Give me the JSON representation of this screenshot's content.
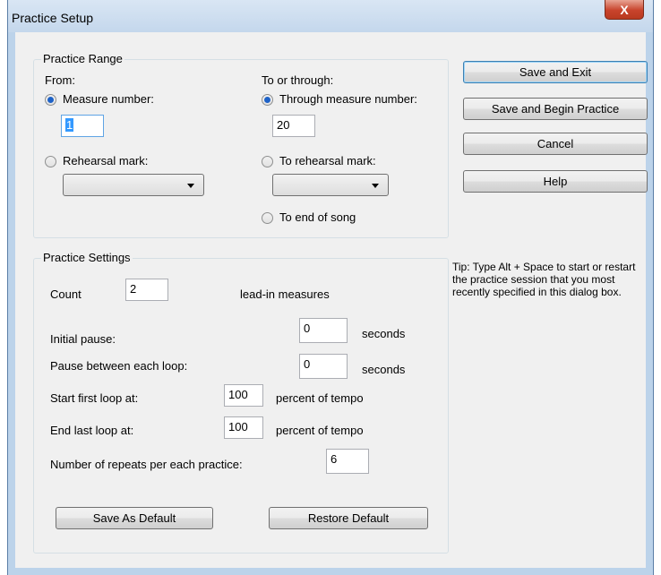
{
  "window": {
    "title": "Practice Setup",
    "close_label": "X"
  },
  "range": {
    "legend": "Practice Range",
    "from_label": "From:",
    "measure_radio": "Measure number:",
    "measure_value": "1",
    "rehearsal_radio": "Rehearsal mark:",
    "to_label": "To or through:",
    "through_radio": "Through measure number:",
    "through_value": "20",
    "to_rehearsal_radio": "To rehearsal mark:",
    "to_end_radio": "To end of song"
  },
  "settings": {
    "legend": "Practice Settings",
    "count_label": "Count",
    "count_value": "2",
    "leadin_label": "lead-in measures",
    "initial_pause_label": "Initial pause:",
    "initial_pause_value": "0",
    "initial_pause_unit": "seconds",
    "loop_pause_label": "Pause between each loop:",
    "loop_pause_value": "0",
    "loop_pause_unit": "seconds",
    "start_loop_label": "Start first loop at:",
    "start_loop_value": "100",
    "start_loop_unit": "percent of tempo",
    "end_loop_label": "End last loop at:",
    "end_loop_value": "100",
    "end_loop_unit": "percent of tempo",
    "repeats_label": "Number of repeats per each practice:",
    "repeats_value": "6",
    "save_default_label": "Save As Default",
    "restore_default_label": "Restore Default"
  },
  "buttons": {
    "save_exit": "Save and Exit",
    "save_begin": "Save and Begin Practice",
    "cancel": "Cancel",
    "help": "Help"
  },
  "tip": "Tip: Type Alt + Space to start or restart the practice session that you most recently specified in this dialog box.",
  "colors": {
    "frame": "#bcd3ea",
    "client": "#f0f0f0",
    "radio_dot": "#1e62c7",
    "close": "#c8432c"
  }
}
